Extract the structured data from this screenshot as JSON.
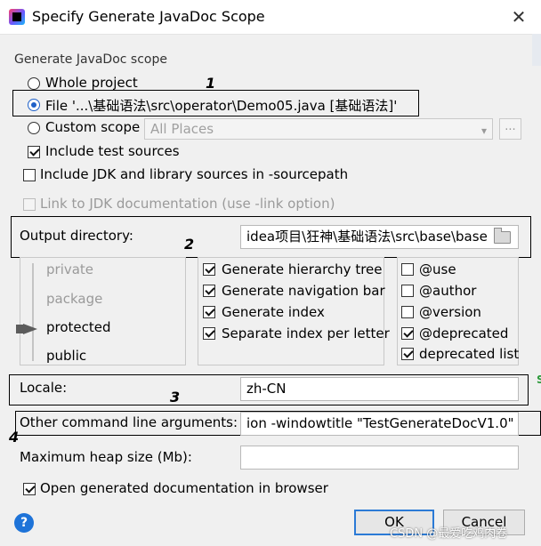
{
  "window": {
    "title": "Specify Generate JavaDoc Scope",
    "close_glyph": "✕"
  },
  "scope": {
    "section_title": "Generate JavaDoc scope",
    "options": [
      {
        "label": "Whole project",
        "selected": false
      },
      {
        "label": "File '...\\基础语法\\src\\operator\\Demo05.java [基础语法]'",
        "selected": true
      },
      {
        "label": "Custom scope",
        "selected": false
      }
    ],
    "custom_scope_value": "All Places",
    "custom_scope_more": "...",
    "include_test_sources": {
      "label": "Include test sources",
      "checked": true
    },
    "include_jdk": {
      "label": "Include JDK and library sources in -sourcepath",
      "checked": false
    },
    "link_jdk": {
      "label": "Link to JDK documentation (use -link option)",
      "checked": false,
      "enabled": false
    }
  },
  "output": {
    "label": "Output directory:",
    "value": "idea项目\\狂神\\基础语法\\src\\base\\base"
  },
  "visibility": {
    "levels": [
      "private",
      "package",
      "protected",
      "public"
    ],
    "selected": "protected"
  },
  "generate_options": [
    {
      "label": "Generate hierarchy tree",
      "checked": true
    },
    {
      "label": "Generate navigation bar",
      "checked": true
    },
    {
      "label": "Generate index",
      "checked": true
    },
    {
      "label": "Separate index per letter",
      "checked": true
    }
  ],
  "tag_options": [
    {
      "label": "@use",
      "checked": false
    },
    {
      "label": "@author",
      "checked": false
    },
    {
      "label": "@version",
      "checked": false
    },
    {
      "label": "@deprecated",
      "checked": true
    },
    {
      "label": "deprecated list",
      "checked": true
    }
  ],
  "locale": {
    "label": "Locale:",
    "value": "zh-CN"
  },
  "other_args": {
    "label": "Other command line arguments:",
    "value": "ion -windowtitle \"TestGenerateDocV1.0\""
  },
  "max_heap": {
    "label": "Maximum heap size (Mb):",
    "value": ""
  },
  "open_in_browser": {
    "label": "Open generated documentation in browser",
    "checked": true
  },
  "buttons": {
    "ok": "OK",
    "cancel": "Cancel",
    "help": "?"
  },
  "annotations": [
    "1",
    "2",
    "3",
    "4"
  ],
  "watermark": "CSDN @最爱吃鸡肉卷",
  "side_mark": "S",
  "colors": {
    "accent": "#1e60c8",
    "default_button_border": "#2b7ad6",
    "disabled_text": "#9a9a9a"
  }
}
